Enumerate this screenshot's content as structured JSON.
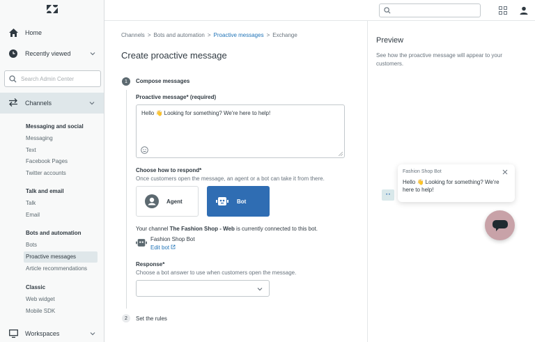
{
  "sidebar": {
    "home": "Home",
    "recently_viewed": "Recently viewed",
    "search_placeholder": "Search Admin Center",
    "channels": "Channels",
    "groups": [
      {
        "heading": "Messaging and social",
        "items": [
          "Messaging",
          "Text",
          "Facebook Pages",
          "Twitter accounts"
        ]
      },
      {
        "heading": "Talk and email",
        "items": [
          "Talk",
          "Email"
        ]
      },
      {
        "heading": "Bots and automation",
        "items": [
          "Bots",
          "Proactive messages",
          "Article recommendations"
        ]
      },
      {
        "heading": "Classic",
        "items": [
          "Web widget",
          "Mobile SDK"
        ]
      }
    ],
    "active_item": "Proactive messages",
    "workspaces": "Workspaces"
  },
  "breadcrumb": [
    "Channels",
    "Bots and automation",
    "Proactive messages",
    "Exchange"
  ],
  "page_title": "Create proactive message",
  "steps": [
    {
      "number": "1",
      "label": "Compose messages"
    },
    {
      "number": "2",
      "label": "Set the rules"
    }
  ],
  "form": {
    "message_label": "Proactive message* (required)",
    "message_value": "Hello 👋 Looking for something? We're here to help!",
    "respond_label": "Choose how to respond*",
    "respond_hint": "Once customers open the message, an agent or a bot can take it from there.",
    "agent_option": "Agent",
    "bot_option": "Bot",
    "channel_text_prefix": "Your channel ",
    "channel_name": "The Fashion Shop - Web",
    "channel_text_suffix": " is currently connected to this bot.",
    "bot_name": "Fashion Shop Bot",
    "edit_bot": "Edit bot",
    "response_label": "Response*",
    "response_hint": "Choose a bot answer to use when customers open the message.",
    "response_value": ""
  },
  "preview": {
    "title": "Preview",
    "description": "See how the proactive message will appear to your customers.",
    "bot_name": "Fashion Shop Bot",
    "message": "Hello 👋 Looking for something? We're here to help!"
  },
  "colors": {
    "primary": "#2f6db3",
    "link": "#1f73b7",
    "launcher": "#c8a2a8",
    "active_bg": "#dfe7ea"
  }
}
